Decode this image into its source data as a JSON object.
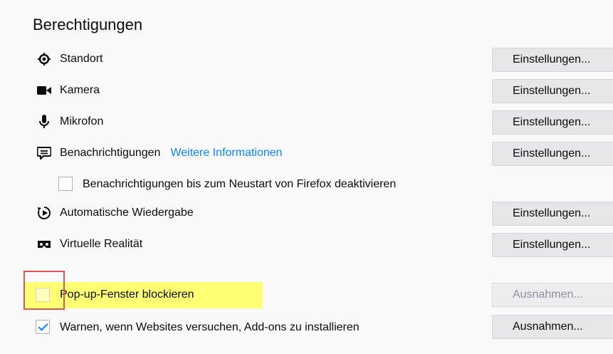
{
  "section_title": "Berechtigungen",
  "permissions": [
    {
      "label": "Standort",
      "button": "Einstellungen...",
      "icon": "location-icon"
    },
    {
      "label": "Kamera",
      "button": "Einstellungen...",
      "icon": "camera-icon"
    },
    {
      "label": "Mikrofon",
      "button": "Einstellungen...",
      "icon": "microphone-icon"
    },
    {
      "label": "Benachrichtigungen",
      "link": "Weitere Informationen",
      "button": "Einstellungen...",
      "icon": "notification-icon"
    },
    {
      "label": "Automatische Wiedergabe",
      "button": "Einstellungen...",
      "icon": "autoplay-icon"
    },
    {
      "label": "Virtuelle Realität",
      "button": "Einstellungen...",
      "icon": "vr-icon"
    }
  ],
  "notifications_pause": {
    "label": "Benachrichtigungen bis zum Neustart von Firefox deaktivieren",
    "checked": false
  },
  "popup_block": {
    "label": "Pop-up-Fenster blockieren",
    "checked": false,
    "button": "Ausnahmen..."
  },
  "addon_warn": {
    "label": "Warnen, wenn Websites versuchen, Add-ons zu installieren",
    "checked": true,
    "button": "Ausnahmen..."
  },
  "colors": {
    "accent": "#0a84ff",
    "highlight": "#ffff73",
    "annotation": "#e05555"
  }
}
